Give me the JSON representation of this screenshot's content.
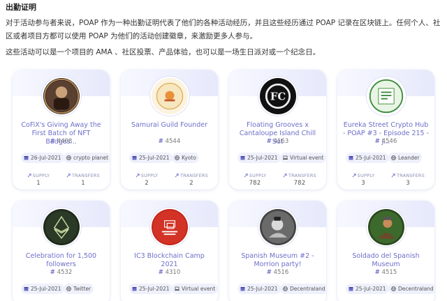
{
  "article": {
    "heading": "出勤证明",
    "paragraph1": "对于活动参与者来说，POAP 作为一种出勤证明代表了他们的各种活动经历，并且这些经历通过 POAP 记录在区块链上。任何个人、社区或者项目方都可以使用 POAP 为他们的活动创建徽章，来激励更多人参与。",
    "paragraph2": "这些活动可以是一个项目的 AMA 、社区投票、产品体验，也可以是一场生日派对或一个纪念日。"
  },
  "labels": {
    "supply": "SUPPLY",
    "transfers": "TRANSFERS"
  },
  "colors": {
    "accent": "#6d6ec9",
    "chip_bg": "#eef0fb",
    "band": "#e6e9fb"
  },
  "cards": [
    {
      "title": "CoFiX's Giving Away the First Batch of NFT Badges...",
      "id": "4408",
      "date": "26-Jul-2021",
      "location": "crypto planet",
      "location_icon": "globe-icon",
      "supply": "1",
      "transfers": "1"
    },
    {
      "title": "Samurai Guild Founder",
      "id": "4544",
      "date": "25-Jul-2021",
      "location": "Kyoto",
      "location_icon": "globe-icon",
      "supply": "2",
      "transfers": "2"
    },
    {
      "title": "Floating Grooves x Cantaloupe Island Chill Set",
      "id": "4163",
      "date": "25-Jul-2021",
      "location": "Virtual event",
      "location_icon": "laptop-icon",
      "supply": "782",
      "transfers": "782"
    },
    {
      "title": "Eureka Street Crypto Hub - POAP #3 - Episode 215 - J...",
      "id": "4546",
      "date": "25-Jul-2021",
      "location": "Leander",
      "location_icon": "globe-icon",
      "supply": "3",
      "transfers": "3"
    },
    {
      "title": "Celebration for 1,500 followers",
      "id": "4532",
      "date": "25-Jul-2021",
      "location": "Twitter",
      "location_icon": "globe-icon"
    },
    {
      "title": "IC3 Blockchain Camp 2021",
      "id": "4310",
      "date": "25-Jul-2021",
      "location": "Virtual event",
      "location_icon": "laptop-icon"
    },
    {
      "title": "Spanish Museum #2 - Morrion party!",
      "id": "4516",
      "date": "25-Jul-2021",
      "location": "Decentraland",
      "location_icon": "globe-icon"
    },
    {
      "title": "Soldado del Spanish Museum",
      "id": "4515",
      "date": "25-Jul-2021",
      "location": "Decentraland",
      "location_icon": "globe-icon"
    }
  ]
}
